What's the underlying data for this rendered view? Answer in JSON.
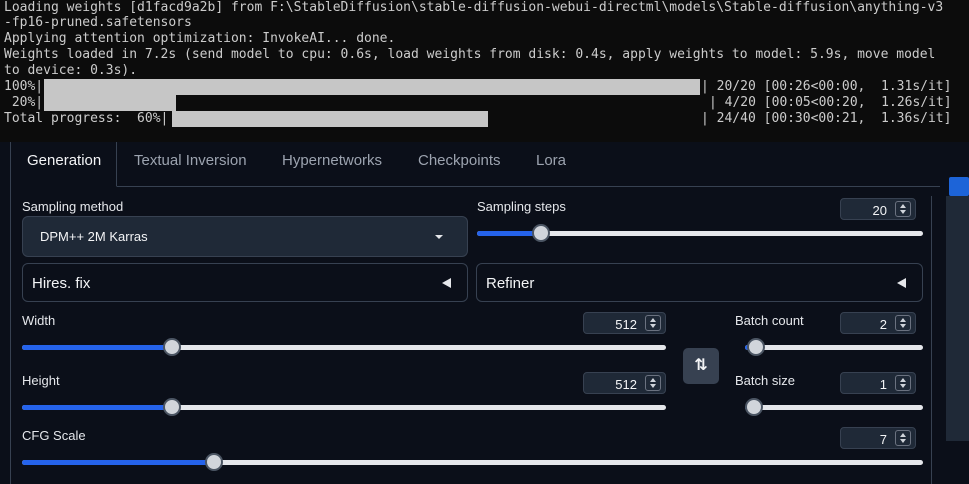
{
  "terminal": {
    "lines": [
      "Loading weights [d1facd9a2b] from F:\\StableDiffusion\\stable-diffusion-webui-directml\\models\\Stable-diffusion\\anything-v3",
      "-fp16-pruned.safetensors",
      "Applying attention optimization: InvokeAI... done.",
      "Weights loaded in 7.2s (send model to cpu: 0.6s, load weights from disk: 0.4s, apply weights to model: 5.9s, move model",
      "to device: 0.3s)."
    ],
    "progress": [
      {
        "prefix": "100%|",
        "fraction": 1.0,
        "suffix": "| 20/20 [00:26<00:00,  1.31s/it]"
      },
      {
        "prefix": " 20%|",
        "fraction": 0.2,
        "suffix": "| 4/20 [00:05<00:20,  1.26s/it]"
      },
      {
        "prefix": "Total progress:  60%|",
        "fraction": 0.6,
        "suffix": "| 24/40 [00:30<00:21,  1.36s/it]"
      }
    ]
  },
  "tabs": [
    {
      "label": "Generation",
      "active": true
    },
    {
      "label": "Textual Inversion",
      "active": false
    },
    {
      "label": "Hypernetworks",
      "active": false
    },
    {
      "label": "Checkpoints",
      "active": false
    },
    {
      "label": "Lora",
      "active": false
    }
  ],
  "sampling_method": {
    "label": "Sampling method",
    "value": "DPM++ 2M Karras"
  },
  "sampling_steps": {
    "label": "Sampling steps",
    "value": "20",
    "min": 1,
    "max": 150,
    "current": 20
  },
  "hires_fix": {
    "label": "Hires. fix"
  },
  "refiner": {
    "label": "Refiner"
  },
  "width": {
    "label": "Width",
    "value": "512",
    "min": 64,
    "max": 2048,
    "current": 512
  },
  "height": {
    "label": "Height",
    "value": "512",
    "min": 64,
    "max": 2048,
    "current": 512
  },
  "batch_count": {
    "label": "Batch count",
    "value": "2",
    "min": 1,
    "max": 100,
    "current": 2
  },
  "batch_size": {
    "label": "Batch size",
    "value": "1",
    "min": 1,
    "max": 8,
    "current": 1
  },
  "cfg_scale": {
    "label": "CFG Scale",
    "value": "7",
    "min": 1,
    "max": 30,
    "current": 7
  },
  "swap_button": {
    "label": "⇅"
  },
  "colors": {
    "accent": "#2563eb",
    "background": "#0b0f19",
    "panel": "#1f2937",
    "terminal_bg": "#0c0c0c"
  }
}
